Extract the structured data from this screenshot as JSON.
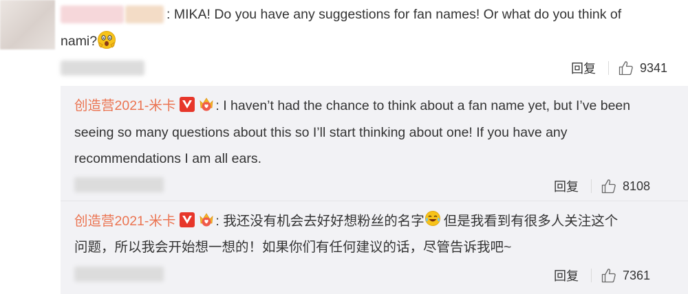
{
  "comment": {
    "text_line1": ": MIKA! Do you have any suggestions for fan names! Or what do you think of",
    "text_line2": "nami?",
    "emoji": "scared-face-emoji",
    "reply_label": "回复",
    "like_count": "9341"
  },
  "replies": [
    {
      "username": "创造营2021-米卡",
      "badges": [
        "verified-v-badge",
        "crown-badge"
      ],
      "text_line1": ": I haven’t had the chance to think about a fan name yet, but I’ve been",
      "text_line2": "seeing so many questions about this so I’ll start thinking about one! If you have any",
      "text_line3": "recommendations I am all ears.",
      "reply_label": "回复",
      "like_count": "8108"
    },
    {
      "username": "创造营2021-米卡",
      "badges": [
        "verified-v-badge",
        "crown-badge"
      ],
      "text_line1a": ": 我还没有机会去好好想粉丝的名字",
      "text_line1b": "但是我看到有很多人关注这个",
      "text_line2": "问题，所以我会开始想一想的！如果你们有任何建议的话，尽管告诉我吧~",
      "emoji": "laughing-tears-emoji",
      "reply_label": "回复",
      "like_count": "7361"
    }
  ],
  "colors": {
    "username": "#eb7350",
    "reply_background": "#f2f2f5",
    "verified_badge": "#e7362a"
  }
}
